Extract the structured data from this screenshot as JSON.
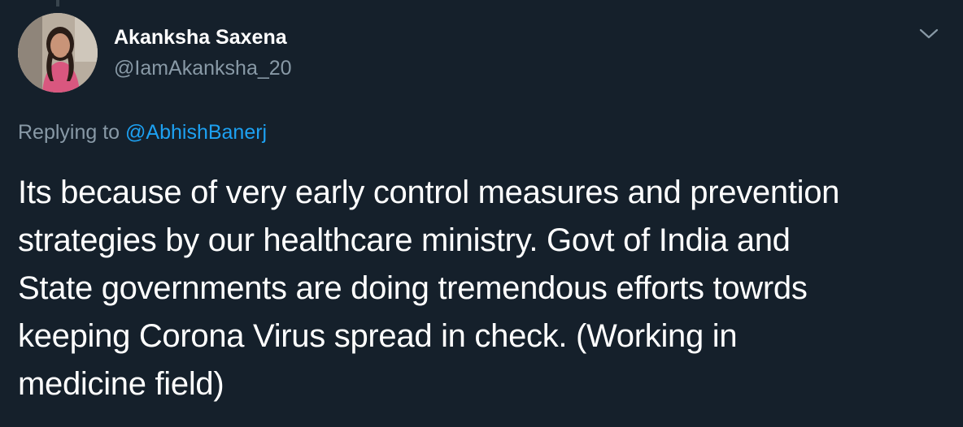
{
  "tweet": {
    "author": {
      "display_name": "Akanksha Saxena",
      "handle": "@IamAkanksha_20"
    },
    "reply_context": {
      "prefix": "Replying to",
      "mention": "@AbhishBanerj"
    },
    "text_lines": [
      "Its because of very early control measures and prevention",
      "strategies by our healthcare ministry. Govt of India and",
      "State governments are doing tremendous efforts towrds",
      "keeping Corona Virus spread in check. (Working in",
      "medicine field)"
    ],
    "menu_icon": "chevron-down-icon"
  },
  "colors": {
    "background": "#15202b",
    "primary_text": "#ffffff",
    "secondary_text": "#8899a6",
    "link": "#1da1f2"
  }
}
